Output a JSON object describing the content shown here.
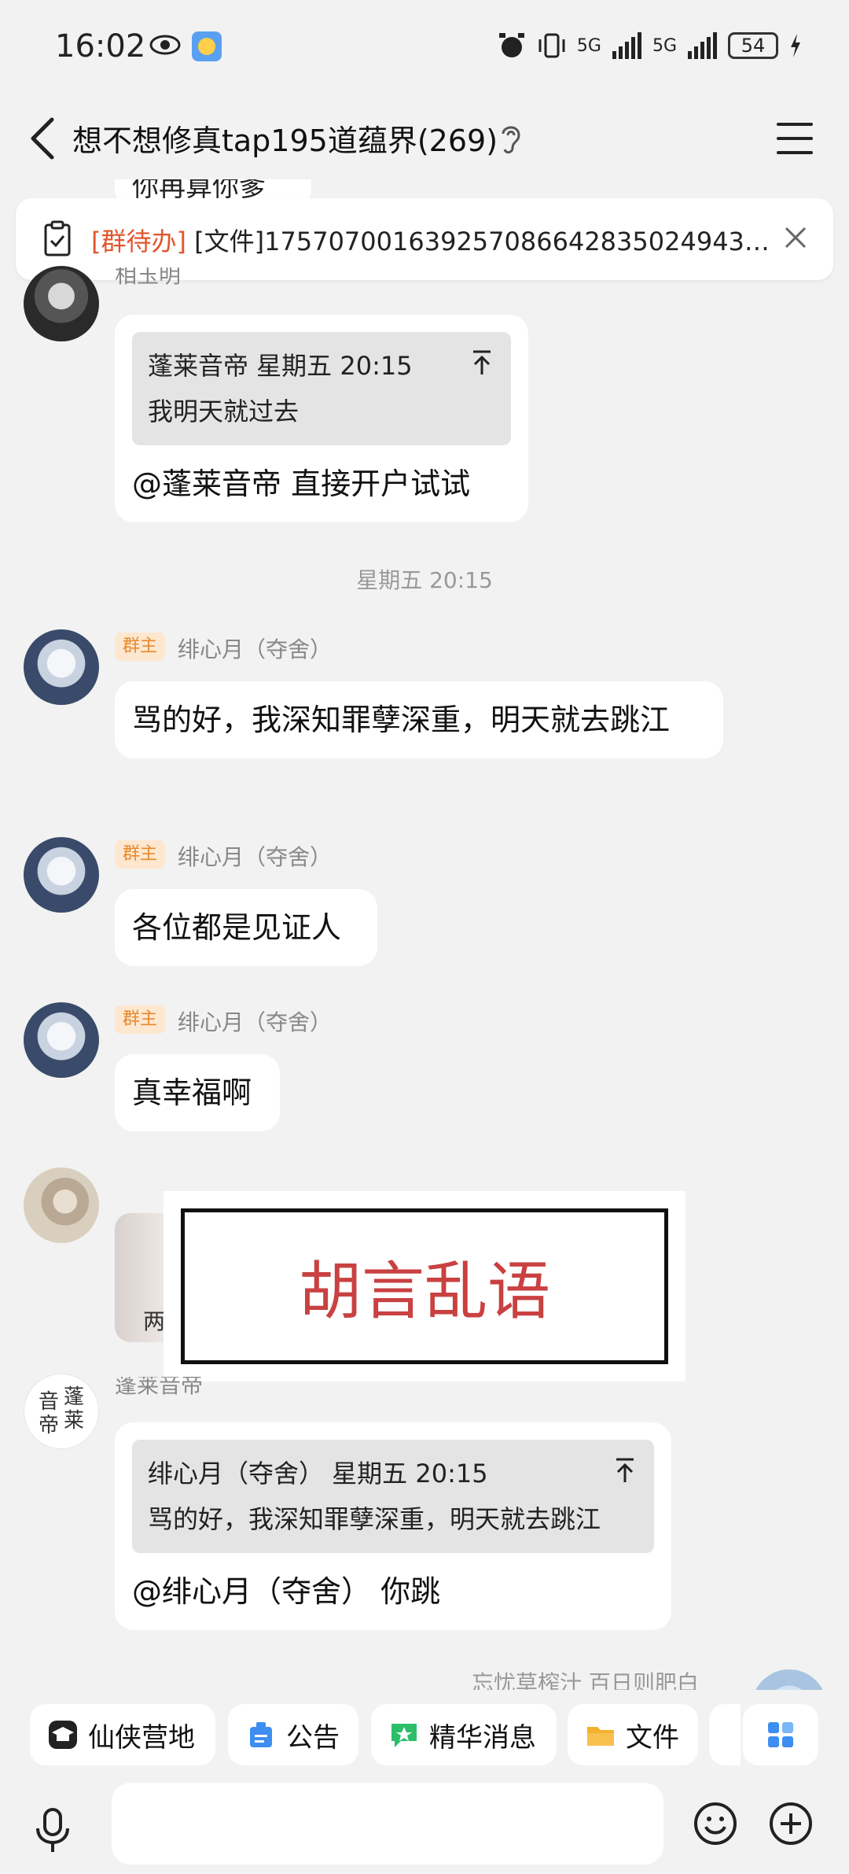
{
  "status_bar": {
    "time": "16:02",
    "network_1": "5G",
    "network_2": "5G",
    "battery": "54"
  },
  "header": {
    "title": "想不想修真tap195道蕴界(269)"
  },
  "top_peek_text": "你再算你爹",
  "todo_bar": {
    "tag": "[群待办]",
    "text": "[文件]1757070016392570866428350249434..."
  },
  "messages": {
    "m1": {
      "nick": "相玉明",
      "quote_header": "蓬莱音帝 星期五 20:15",
      "quote_text": "我明天就过去",
      "text": "@蓬莱音帝 直接开户试试"
    },
    "timestamp": "星期五 20:15",
    "m2": {
      "badge": "群主",
      "nick": "绯心月（夺舍）",
      "text": "骂的好，我深知罪孽深重，明天就去跳江"
    },
    "m3": {
      "badge": "群主",
      "nick": "绯心月（夺舍）",
      "text": "各位都是见证人"
    },
    "m4": {
      "badge": "群主",
      "nick": "绯心月（夺舍）",
      "text": "真幸福啊"
    },
    "m5": {
      "thumb_text": "两"
    },
    "m6": {
      "nick": "蓬莱音帝",
      "quote_header": "绯心月（夺舍） 星期五 20:15",
      "quote_text": "骂的好，我深知罪孽深重，明天就去跳江",
      "text": "@绯心月（夺舍） 你跳"
    },
    "next_peek": "忘忧草榨汁 百日则肥白"
  },
  "overlay_stamp": "胡言乱语",
  "seal_avatar": {
    "chars": [
      "音",
      "蓬",
      "帝",
      "莱"
    ]
  },
  "toolbar": {
    "items": [
      {
        "label": "仙侠营地",
        "icon": "campus-hat-icon"
      },
      {
        "label": "公告",
        "icon": "announcement-icon"
      },
      {
        "label": "精华消息",
        "icon": "essence-icon"
      },
      {
        "label": "文件",
        "icon": "folder-icon"
      }
    ]
  },
  "colors": {
    "accent_orange": "#e0572e",
    "badge_bg": "#fde7cf",
    "badge_text": "#e8882c",
    "stamp_red": "#c94141"
  }
}
